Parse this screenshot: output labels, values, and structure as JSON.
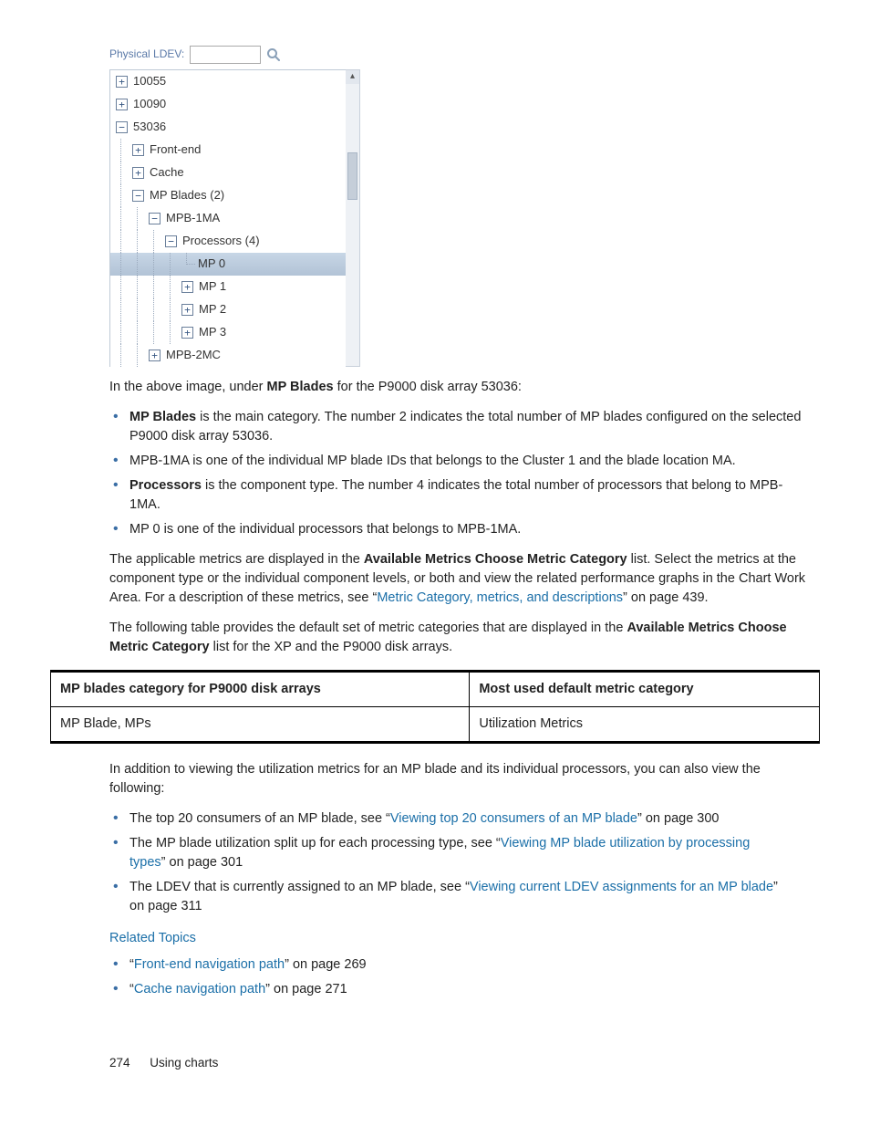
{
  "tree": {
    "search_label": "Physical LDEV:",
    "search_value": "",
    "rows": [
      {
        "indent": 0,
        "exp": "+",
        "label": "10055"
      },
      {
        "indent": 0,
        "exp": "+",
        "label": "10090"
      },
      {
        "indent": 0,
        "exp": "−",
        "label": "53036"
      },
      {
        "indent": 1,
        "exp": "+",
        "label": "Front-end"
      },
      {
        "indent": 1,
        "exp": "+",
        "label": "Cache"
      },
      {
        "indent": 1,
        "exp": "−",
        "label": "MP Blades (2)"
      },
      {
        "indent": 2,
        "exp": "−",
        "label": "MPB-1MA"
      },
      {
        "indent": 3,
        "exp": "−",
        "label": "Processors (4)"
      },
      {
        "indent": 4,
        "exp": "",
        "label": "MP 0",
        "selected": true,
        "leaf": true
      },
      {
        "indent": 4,
        "exp": "+",
        "label": "MP 1"
      },
      {
        "indent": 4,
        "exp": "+",
        "label": "MP 2"
      },
      {
        "indent": 4,
        "exp": "+",
        "label": "MP 3"
      },
      {
        "indent": 2,
        "exp": "+",
        "label": "MPB-2MC"
      }
    ]
  },
  "para1_a": "In the above image, under ",
  "para1_b": "MP Blades",
  "para1_c": " for the P9000 disk array 53036:",
  "bul1": {
    "i1_b": "MP Blades",
    "i1_t": " is the main category. The number 2 indicates the total number of MP blades configured on the selected P9000 disk array 53036.",
    "i2": "MPB-1MA is one of the individual MP blade IDs that belongs to the Cluster 1 and the blade location MA.",
    "i3_b": "Processors",
    "i3_t": " is the component type. The number 4 indicates the total number of processors that belong to MPB-1MA.",
    "i4": "MP 0 is one of the individual processors that belongs to MPB-1MA."
  },
  "para2_a": "The applicable metrics are displayed in the ",
  "para2_b": "Available Metrics Choose Metric Category",
  "para2_c": " list. Select the metrics at the component type or the individual component levels, or both and view the related performance graphs in the Chart Work Area. For a description of these metrics, see “",
  "para2_link": "Metric Category, metrics, and descriptions",
  "para2_d": "” on page 439.",
  "para3_a": "The following table provides the default set of metric categories that are displayed in the ",
  "para3_b": "Available Metrics Choose Metric Category",
  "para3_c": " list for the XP and the P9000 disk arrays.",
  "table": {
    "h1": "MP blades category for P9000 disk arrays",
    "h2": "Most used default metric category",
    "c1": "MP Blade, MPs",
    "c2": "Utilization Metrics"
  },
  "para4": "In addition to viewing the utilization metrics for an MP blade and its individual processors, you can also view the following:",
  "bul2": {
    "i1_a": "The top 20 consumers of an MP blade, see “",
    "i1_link": "Viewing top 20 consumers of an MP blade",
    "i1_b": "” on page 300",
    "i2_a": "The MP blade utilization split up for each processing type, see “",
    "i2_link": "Viewing MP blade utilization by processing types",
    "i2_b": "” on page 301",
    "i3_a": "The LDEV that is currently assigned to an MP blade, see “",
    "i3_link": "Viewing current LDEV assignments for an MP blade",
    "i3_b": "” on page 311"
  },
  "related_label": "Related Topics",
  "related": {
    "r1_q1": "“",
    "r1_link": "Front-end navigation path",
    "r1_q2": "” on page 269",
    "r2_q1": "“",
    "r2_link": "Cache navigation path",
    "r2_q2": "” on page 271"
  },
  "footer": {
    "page": "274",
    "section": "Using charts"
  }
}
